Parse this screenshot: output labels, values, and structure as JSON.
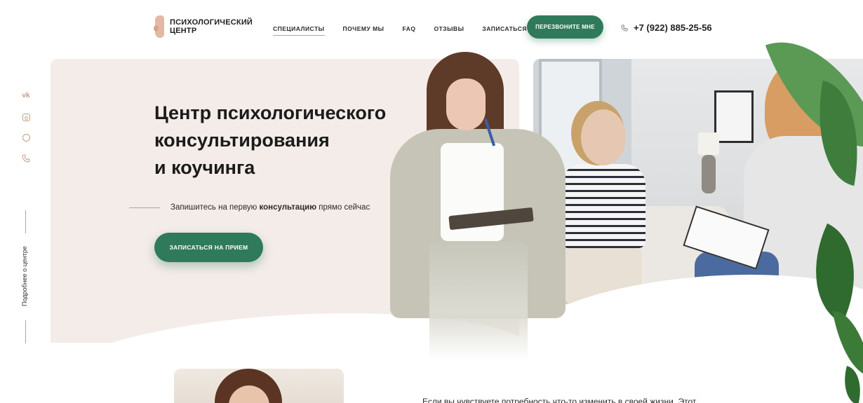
{
  "brand": {
    "name_line1": "ПСИХОЛОГИЧЕСКИЙ",
    "name_line2": "ЦЕНТР"
  },
  "nav": {
    "items": [
      {
        "label": "СПЕЦИАЛИСТЫ",
        "active": true
      },
      {
        "label": "ПОЧЕМУ МЫ",
        "active": false
      },
      {
        "label": "FAQ",
        "active": false
      },
      {
        "label": "ОТЗЫВЫ",
        "active": false
      },
      {
        "label": "ЗАПИСАТЬСЯ",
        "active": false
      }
    ]
  },
  "header": {
    "callback_label": "ПЕРЕЗВОНИТЕ МНЕ",
    "phone": "+7 (922) 885-25-56"
  },
  "socials": {
    "vk": "vk-icon",
    "instagram": "instagram-icon",
    "whatsapp": "whatsapp-icon",
    "viber": "viber-icon",
    "vk_glyph": "vk",
    "about_label": "Подробнее о центре"
  },
  "hero": {
    "title_line1": "Центр психологического",
    "title_line2": "консультирования",
    "title_line3": "и коучинга",
    "subtitle_before": "Запишитесь на первую ",
    "subtitle_bold": "консультацию",
    "subtitle_after": " прямо сейчас",
    "cta_label": "ЗАПИСАТЬСЯ НА ПРИЕМ"
  },
  "about": {
    "intro_text": "Если вы чувствуете потребность что-то изменить в своей жизни. Этот"
  },
  "colors": {
    "accent_green": "#2f7a5b",
    "accent_peach": "#c59c86",
    "hero_bg": "#f4ece8"
  }
}
